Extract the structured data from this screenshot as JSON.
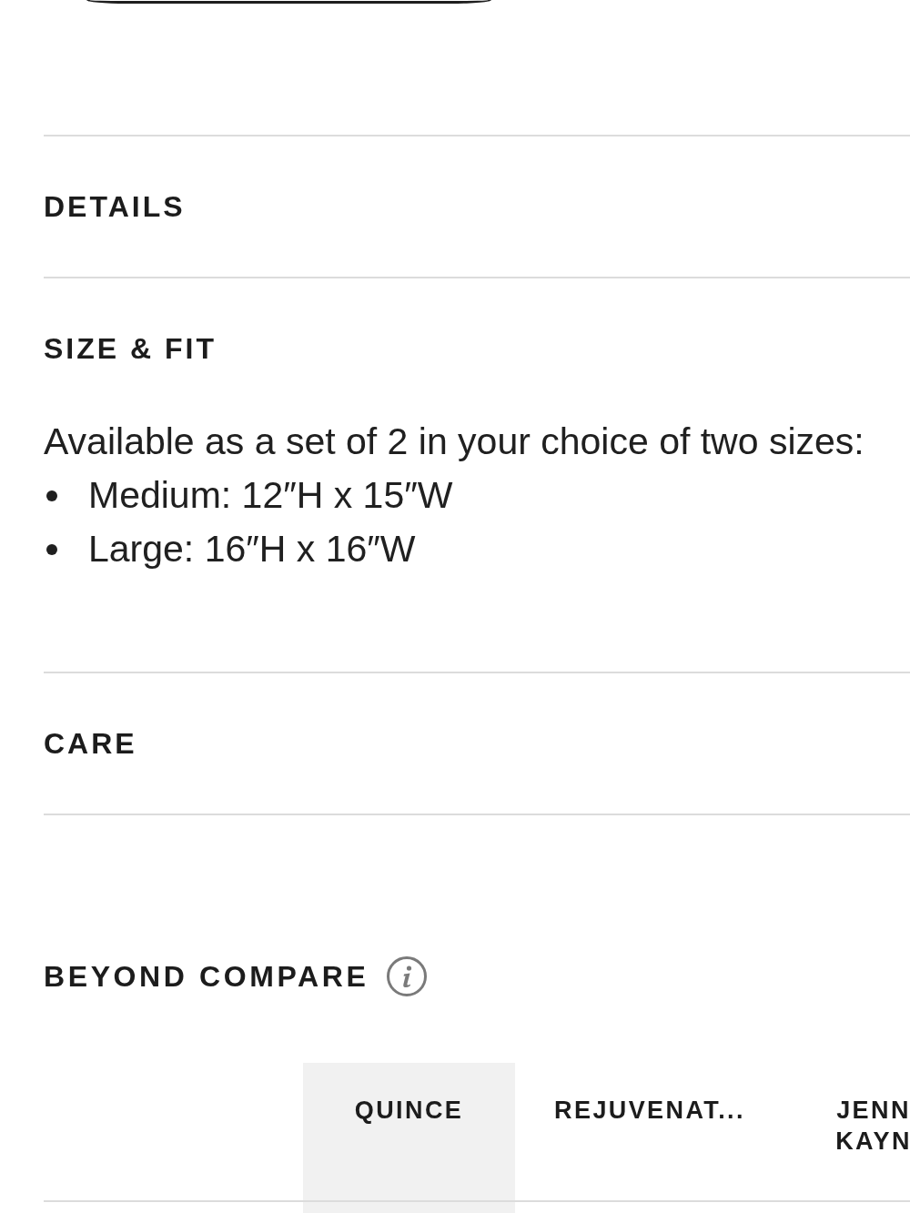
{
  "accordion": [
    {
      "title": "DETAILS"
    },
    {
      "title": "SIZE & FIT",
      "intro": "Available as a set of 2 in your choice of two sizes:",
      "bullets": [
        "Medium: 12″H x 15″W",
        "Large: 16″H x 16″W"
      ]
    },
    {
      "title": "CARE"
    }
  ],
  "compare": {
    "title": "BEYOND COMPARE",
    "columns": [
      {
        "label": "QUINCE",
        "highlighted": true
      },
      {
        "label": "REJUVENAT...",
        "highlighted": false
      },
      {
        "label": "JENN KAYN",
        "highlighted": false
      }
    ]
  }
}
